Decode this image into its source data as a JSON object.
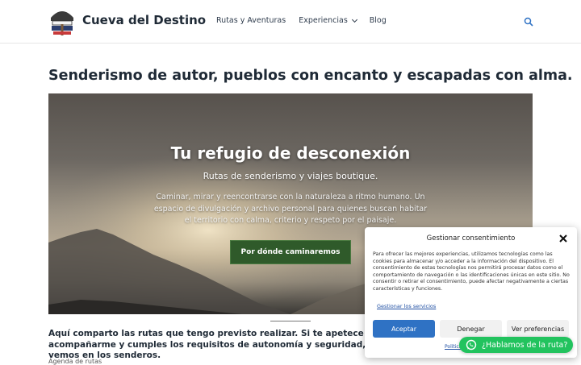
{
  "header": {
    "site_title": "Cueva del Destino",
    "logo_alt": "Cueva del Destino logo",
    "nav": [
      {
        "label": "Rutas y Aventuras"
      },
      {
        "label": "Experiencias"
      },
      {
        "label": "Blog"
      }
    ],
    "icons": {
      "search": "search-icon",
      "dropdown": "chevron-down-icon"
    }
  },
  "main": {
    "headline": "Senderismo de autor, pueblos con encanto y escapadas con alma.",
    "hero": {
      "title": "Tu refugio de desconexión",
      "subtitle": "Rutas de senderismo y viajes boutique.",
      "description": "Caminar, mirar y reencontrarse con la naturaleza a ritmo humano. Un espacio de divulgación y archivo personal para quienes buscan habitar el territorio con calma, criterio y respeto por el paisaje.",
      "button_label": "Por dónde caminaremos"
    },
    "intro": "Aquí comparto las rutas que tengo previsto realizar. Si te apetece acompañarme y cumples los requisitos de autonomía y seguridad, nos vemos en los senderos.",
    "agenda_label": "Agenda de rutas"
  },
  "consent": {
    "title": "Gestionar consentimiento",
    "text": "Para ofrecer las mejores experiencias, utilizamos tecnologías como las cookies para almacenar y/o acceder a la información del dispositivo. El consentimiento de estas tecnologías nos permitirá procesar datos como el comportamiento de navegación o las identificaciones únicas en este sitio. No consentir o retirar el consentimiento, puede afectar negativamente a ciertas características y funciones.",
    "services_link": "Gestionar los servicios",
    "accept_label": "Aceptar",
    "deny_label": "Denegar",
    "prefs_label": "Ver preferencias",
    "policy_link": "Política",
    "accent": "#2f72c4"
  },
  "whatsapp": {
    "label": "¿Hablamos de la ruta?",
    "icon": "whatsapp-icon",
    "color": "#22c35e"
  }
}
